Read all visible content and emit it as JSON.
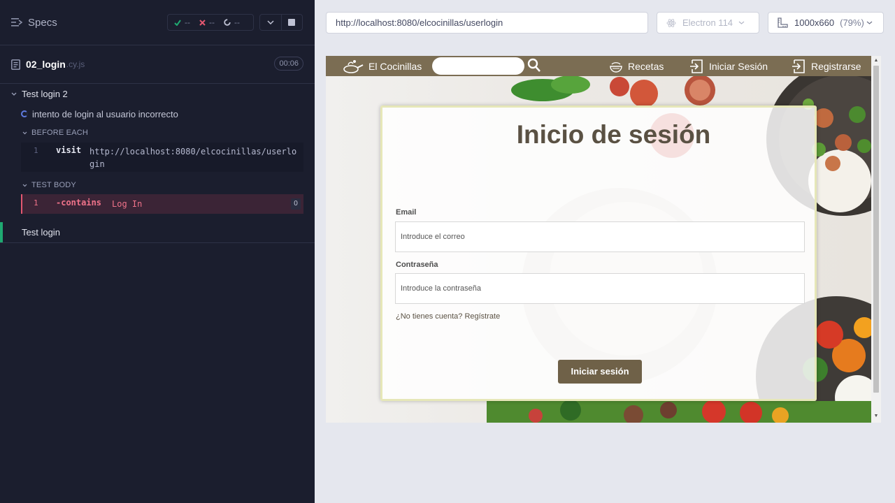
{
  "reporter": {
    "header_title": "Specs",
    "stats": {
      "passed": "--",
      "failed": "--",
      "pending": "--"
    },
    "spec_file": {
      "name": "02_login",
      "ext": ".cy.js",
      "duration": "00:06"
    },
    "suites": [
      {
        "title": "Test login 2",
        "test": {
          "title": "intento de login al usuario incorrecto",
          "before_each_label": "BEFORE EACH",
          "before_each_cmd": {
            "num": "1",
            "name": "visit",
            "arg": "http://localhost:8080/elcocinillas/userlogin"
          },
          "body_label": "TEST BODY",
          "body_cmd": {
            "num": "1",
            "name": "-contains",
            "arg": "Log In",
            "count": "0"
          }
        }
      },
      {
        "title": "Test login"
      }
    ]
  },
  "browser": {
    "url": "http://localhost:8080/elcocinillas/userlogin",
    "name": "Electron 114",
    "viewport": "1000x660",
    "zoom": "(79%)"
  },
  "app": {
    "brand": "El Cocinillas",
    "search_placeholder": "",
    "nav": {
      "recipes": "Recetas",
      "login": "Iniciar Sesión",
      "register": "Registrarse"
    },
    "login_card": {
      "title": "Inicio de sesión",
      "email_label": "Email",
      "email_placeholder": "Introduce el correo",
      "password_label": "Contraseña",
      "password_placeholder": "Introduce la contraseña",
      "register_link": "¿No tienes cuenta? Regístrate",
      "submit_label": "Iniciar sesión"
    }
  },
  "colors": {
    "reporter_bg": "#1b1e2e",
    "pass_green": "#1fa971",
    "fail_red": "#e45770",
    "nav_brown": "#7b6d53",
    "button_brown": "#6f6148"
  }
}
